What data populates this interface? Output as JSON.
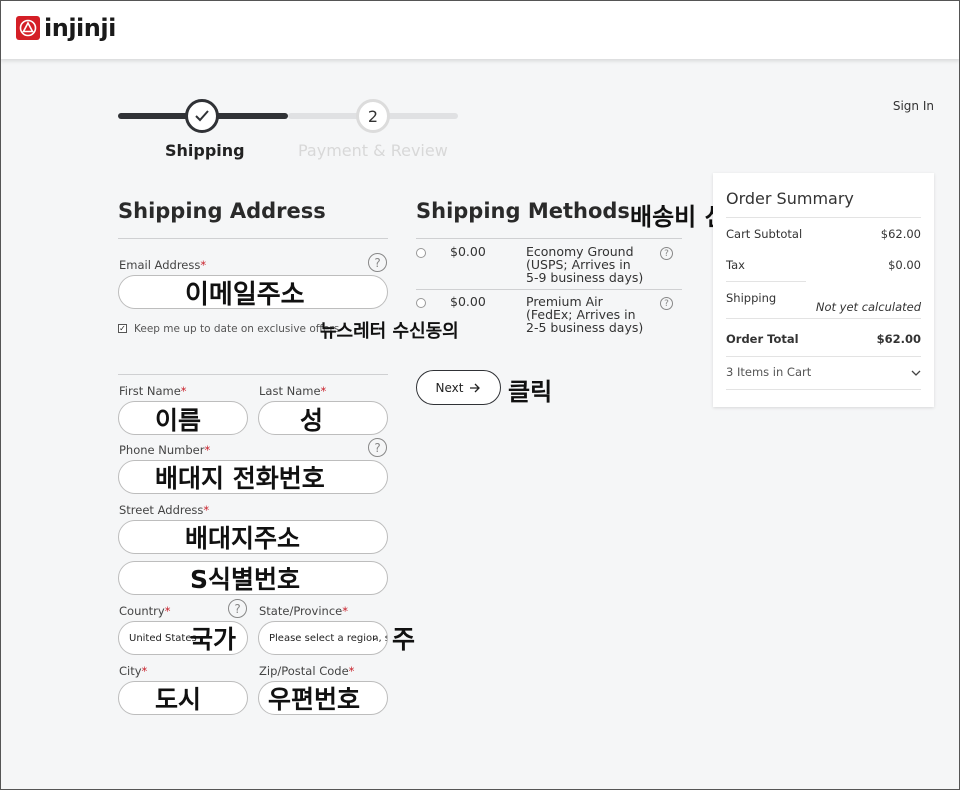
{
  "header": {
    "logo_text": "injinji",
    "sign_in": "Sign In"
  },
  "stepper": {
    "step1_label": "Shipping",
    "step2_number": "2",
    "step2_label": "Payment & Review"
  },
  "address": {
    "title": "Shipping Address",
    "email_label": "Email Address",
    "email_annotation": "이메일주소",
    "newsletter_label": "Keep me up to date on exclusive offers",
    "newsletter_annotation": "뉴스레터 수신동의",
    "first_name_label": "First Name",
    "first_name_annotation": "이름",
    "last_name_label": "Last Name",
    "last_name_annotation": "성",
    "phone_label": "Phone Number",
    "phone_annotation": "배대지 전화번호",
    "street_label": "Street Address",
    "street_annotation_1": "배대지주소",
    "street_annotation_2": "S식별번호",
    "country_label": "Country",
    "country_value": "United States",
    "country_annotation": "국가",
    "state_label": "State/Province",
    "state_value": "Please select a region, s",
    "state_annotation": "주",
    "city_label": "City",
    "city_annotation": "도시",
    "zip_label": "Zip/Postal Code",
    "zip_annotation": "우편번호",
    "required_mark": "*"
  },
  "methods": {
    "title": "Shipping Methods",
    "title_annotation": "배송비 선택",
    "options": [
      {
        "price": "$0.00",
        "name": "Economy Ground (USPS; Arrives in 5-9 business days)"
      },
      {
        "price": "$0.00",
        "name": "Premium Air (FedEx; Arrives in 2-5 business days)"
      }
    ],
    "next_label": "Next",
    "next_annotation": "클릭"
  },
  "summary": {
    "title": "Order Summary",
    "subtotal_label": "Cart Subtotal",
    "subtotal_value": "$62.00",
    "tax_label": "Tax",
    "tax_value": "$0.00",
    "shipping_label": "Shipping",
    "shipping_value": "Not yet calculated",
    "total_label": "Order Total",
    "total_value": "$62.00",
    "items_label": "3 Items in Cart"
  },
  "colors": {
    "brand_red": "#d41f26",
    "dark": "#303236",
    "required": "#c8202a"
  }
}
